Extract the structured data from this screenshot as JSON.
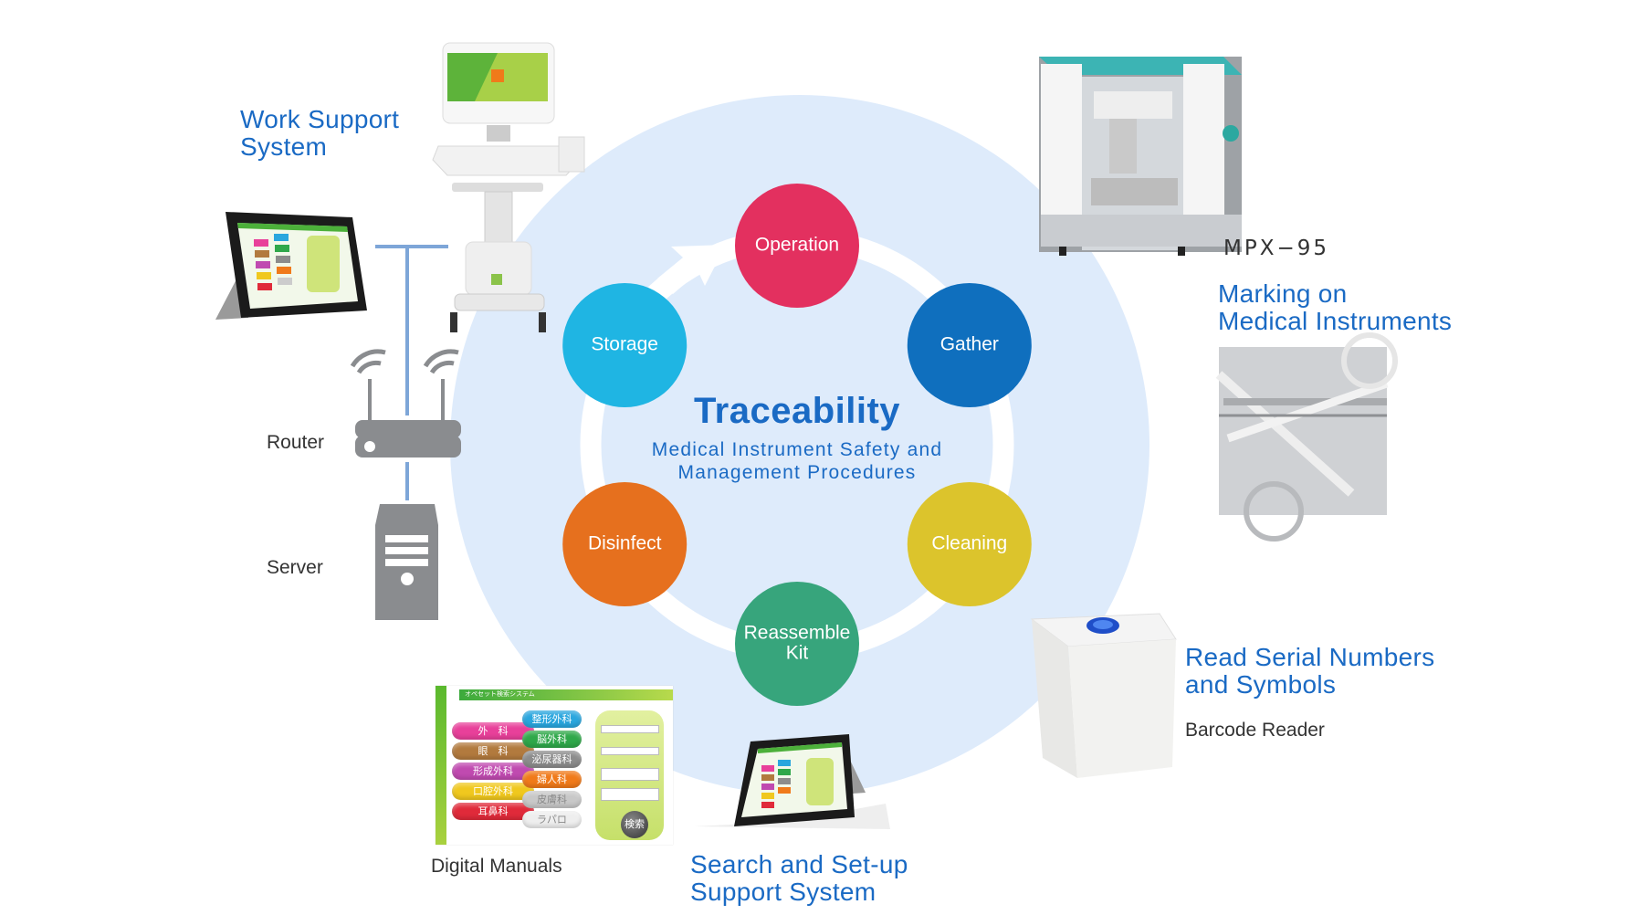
{
  "center": {
    "title": "Traceability",
    "subtitle_line1": "Medical Instrument Safety and",
    "subtitle_line2": "Management Procedures"
  },
  "cycle_stages": [
    {
      "label_line1": "Operation",
      "label_line2": "",
      "color": "#e3305f"
    },
    {
      "label_line1": "Gather",
      "label_line2": "",
      "color": "#0f6fbe"
    },
    {
      "label_line1": "Cleaning",
      "label_line2": "",
      "color": "#dcc42c"
    },
    {
      "label_line1": "Reassemble",
      "label_line2": "Kit",
      "color": "#37a57c"
    },
    {
      "label_line1": "Disinfect",
      "label_line2": "",
      "color": "#e6701e"
    },
    {
      "label_line1": "Storage",
      "label_line2": "",
      "color": "#1fb5e3"
    }
  ],
  "colors": {
    "accent_text": "#1a6ac4",
    "background_circle": "#deebfb",
    "ring": "#ffffff",
    "network_line": "#7ea6d8",
    "icon_gray": "#8a8c8f"
  },
  "work_support": {
    "title_line1": "Work Support",
    "title_line2": "System"
  },
  "network": {
    "router_label": "Router",
    "server_label": "Server"
  },
  "marking": {
    "model_label": "MPX−95",
    "title_line1": "Marking on",
    "title_line2": "Medical Instruments"
  },
  "reader": {
    "title_line1": "Read Serial Numbers",
    "title_line2": "and Symbols",
    "device_label": "Barcode Reader"
  },
  "manuals": {
    "label": "Digital Manuals"
  },
  "search_system": {
    "title_line1": "Search and Set-up",
    "title_line2": "Support System",
    "screen": {
      "header": "オペセット検索システム",
      "left_buttons": [
        {
          "label": "外　科",
          "color": "#e8409a"
        },
        {
          "label": "眼　科",
          "color": "#b27a3e"
        },
        {
          "label": "形成外科",
          "color": "#c04ab0"
        },
        {
          "label": "口腔外科",
          "color": "#f0c81e"
        },
        {
          "label": "耳鼻科",
          "color": "#e02a3a"
        }
      ],
      "right_buttons": [
        {
          "label": "整形外科",
          "color": "#2aa6de"
        },
        {
          "label": "脳外科",
          "color": "#2fa84a"
        },
        {
          "label": "泌尿器科",
          "color": "#8c8c8c"
        },
        {
          "label": "婦人科",
          "color": "#f07a1a"
        },
        {
          "label": "皮膚科",
          "color": "#c8c8c8"
        },
        {
          "label": "ラパロ",
          "color": "#eeeeee"
        }
      ],
      "search_button": "検索"
    }
  }
}
